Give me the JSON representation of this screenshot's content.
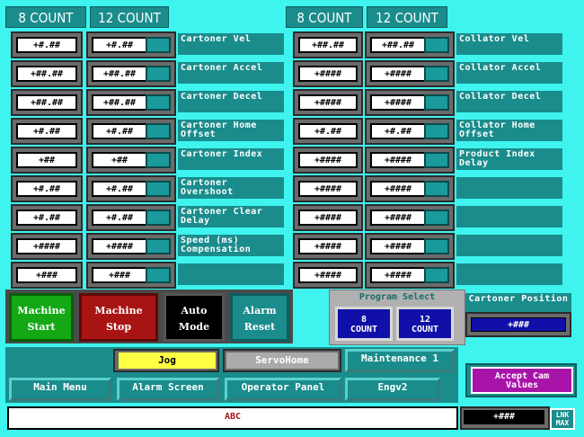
{
  "headers": {
    "left_8": "8 COUNT",
    "left_12": "12 COUNT",
    "right_8": "8 COUNT",
    "right_12": "12 COUNT"
  },
  "left_rows": [
    {
      "c8": "+#.##",
      "c12": "+#.##",
      "label": "Cartoner Vel"
    },
    {
      "c8": "+##.##",
      "c12": "+##.##",
      "label": "Cartoner Accel"
    },
    {
      "c8": "+##.##",
      "c12": "+##.##",
      "label": "Cartoner Decel"
    },
    {
      "c8": "+#.##",
      "c12": "+#.##",
      "label": "Cartoner Home Offset"
    },
    {
      "c8": "+##",
      "c12": "+##",
      "label": "Cartoner Index"
    },
    {
      "c8": "+#.##",
      "c12": "+#.##",
      "label": "Cartoner Overshoot"
    },
    {
      "c8": "+#.##",
      "c12": "+#.##",
      "label": "Cartoner Clear Delay"
    },
    {
      "c8": "+####",
      "c12": "+####",
      "label": "Speed     (ms) Compensation"
    },
    {
      "c8": "+###",
      "c12": "+###",
      "label": ""
    }
  ],
  "right_rows": [
    {
      "c8": "+##.##",
      "c12": "+##.##",
      "label": "Collator Vel"
    },
    {
      "c8": "+####",
      "c12": "+####",
      "label": "Collator Accel"
    },
    {
      "c8": "+####",
      "c12": "+####",
      "label": "Collator Decel"
    },
    {
      "c8": "+#.##",
      "c12": "+#.##",
      "label": "Collator Home Offset"
    },
    {
      "c8": "+####",
      "c12": "+####",
      "label": "Product Index Delay"
    },
    {
      "c8": "+####",
      "c12": "+####",
      "label": ""
    },
    {
      "c8": "+####",
      "c12": "+####",
      "label": ""
    },
    {
      "c8": "+####",
      "c12": "+####",
      "label": ""
    },
    {
      "c8": "+####",
      "c12": "+####",
      "label": ""
    }
  ],
  "controls": {
    "machine_start_1": "Machine",
    "machine_start_2": "Start",
    "machine_stop_1": "Machine",
    "machine_stop_2": "Stop",
    "auto_mode_1": "Auto",
    "auto_mode_2": "Mode",
    "alarm_reset_1": "Alarm",
    "alarm_reset_2": "Reset"
  },
  "program_select": {
    "title": "Program Select",
    "btn8_1": "8",
    "btn8_2": "COUNT",
    "btn12_1": "12",
    "btn12_2": "COUNT"
  },
  "cartoner_position": {
    "title": "Cartoner Position",
    "value": "+###"
  },
  "nav": {
    "jog": "Jog",
    "servohome": "ServoHome",
    "maintenance": "Maintenance 1",
    "accept_cam": "Accept Cam Values",
    "main_menu": "Main Menu",
    "alarm_screen": "Alarm Screen",
    "operator_panel": "Operator Panel",
    "engv2": "Engv2"
  },
  "status": {
    "message": "ABC",
    "value": "+###",
    "lnk_1": "LNK",
    "lnk_2": "MAX"
  },
  "colors": {
    "background": "#3ff4ee",
    "teal": "#1a8c8c",
    "start_green": "#14a814",
    "stop_red": "#a81414",
    "program_blue": "#1010a8",
    "jog_yellow": "#ffff44",
    "accept_purple": "#a814a8"
  }
}
